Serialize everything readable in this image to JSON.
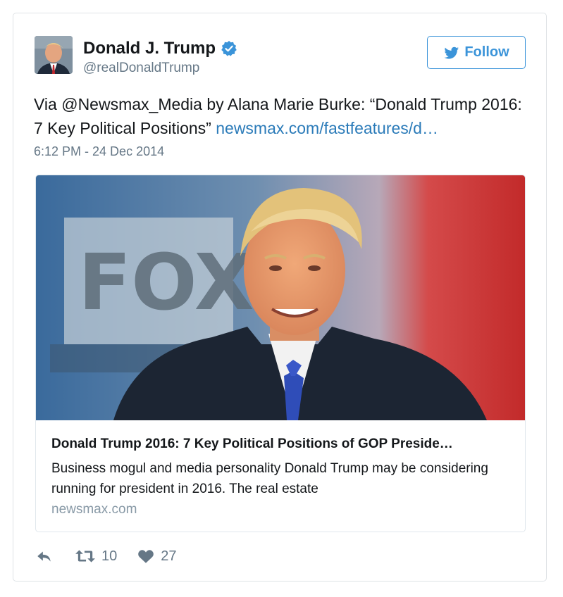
{
  "user": {
    "name": "Donald J. Trump",
    "handle": "@realDonaldTrump",
    "verified": true
  },
  "follow_label": "Follow",
  "tweet": {
    "text_plain": "Via @Newsmax_Media by Alana Marie Burke: “Donald Trump 2016: 7 Key Political Positions” ",
    "link_text": "newsmax.com/fastfeatures/d…",
    "timestamp": "6:12 PM - 24 Dec 2014"
  },
  "card": {
    "title": "Donald Trump 2016: 7 Key Political Positions of GOP Preside…",
    "description": "Business mogul and media personality Donald Trump may be considering running for president in 2016. The real estate",
    "domain": "newsmax.com",
    "image_text": "FOX"
  },
  "actions": {
    "retweet_count": "10",
    "like_count": "27"
  },
  "colors": {
    "link": "#2b7bb9",
    "follow_blue": "#3b94d9",
    "muted": "#657786"
  }
}
